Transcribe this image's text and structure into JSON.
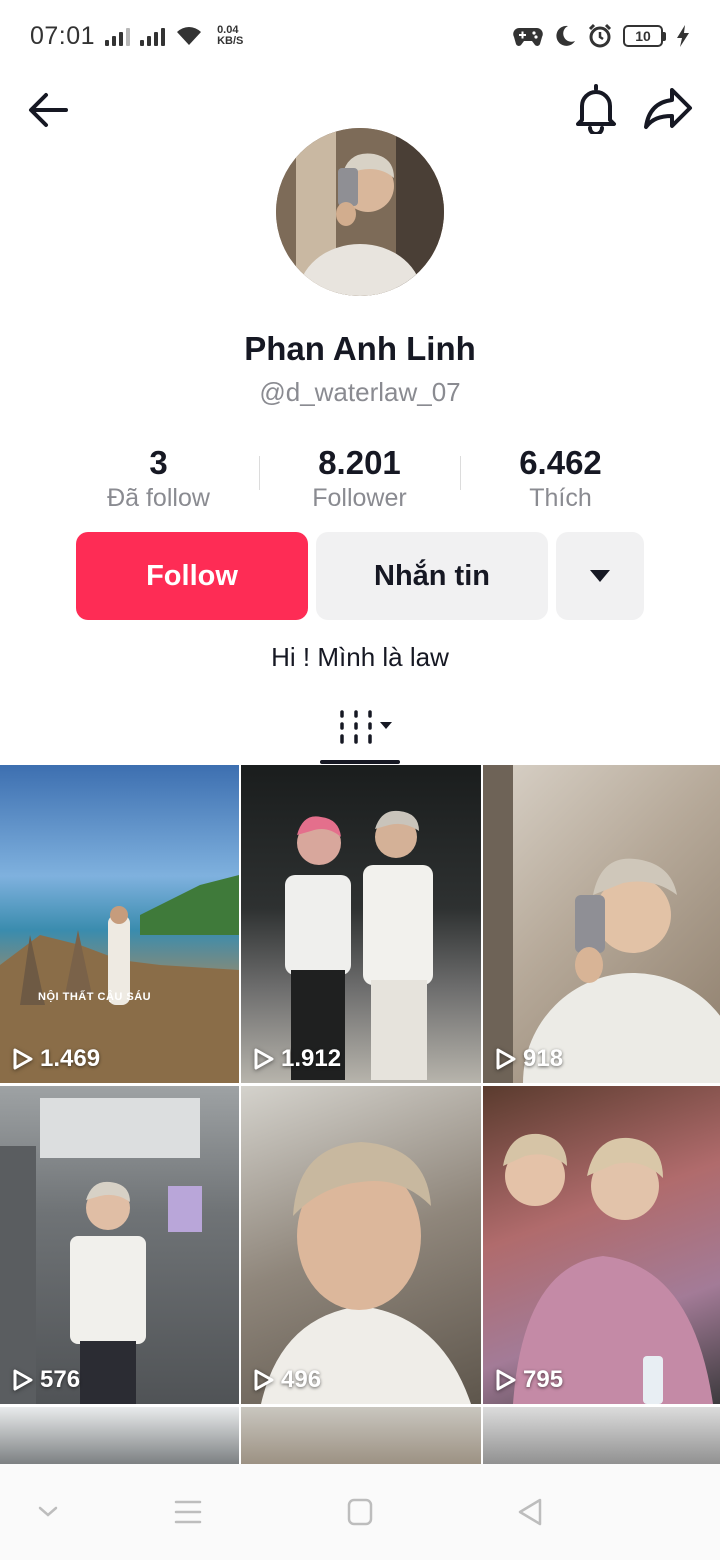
{
  "status_bar": {
    "time": "07:01",
    "net_speed_value": "0.04",
    "net_speed_unit": "KB/S",
    "battery_level": "10",
    "icons": [
      "signal-icon",
      "signal-icon",
      "wifi-icon",
      "game-icon",
      "moon-icon",
      "alarm-icon",
      "battery-icon",
      "charging-icon"
    ]
  },
  "nav": {
    "icons": [
      "back-arrow-icon",
      "bell-icon",
      "share-icon"
    ]
  },
  "profile": {
    "name": "Phan Anh Linh",
    "handle": "@d_waterlaw_07",
    "bio": "Hi ! Mình là law"
  },
  "stats": [
    {
      "value": "3",
      "label": "Đã follow"
    },
    {
      "value": "8.201",
      "label": "Follower"
    },
    {
      "value": "6.462",
      "label": "Thích"
    }
  ],
  "actions": {
    "follow_label": "Follow",
    "message_label": "Nhắn tin"
  },
  "grid": {
    "videos": [
      {
        "views": "1.469",
        "caption": "NỘI THẤT CẬU SÁU"
      },
      {
        "views": "1.912"
      },
      {
        "views": "918"
      },
      {
        "views": "576"
      },
      {
        "views": "496"
      },
      {
        "views": "795"
      }
    ]
  },
  "colors": {
    "accent": "#fe2c55",
    "secondary_button": "#f1f1f2",
    "text_primary": "#161823",
    "text_secondary": "#8a8b91"
  }
}
